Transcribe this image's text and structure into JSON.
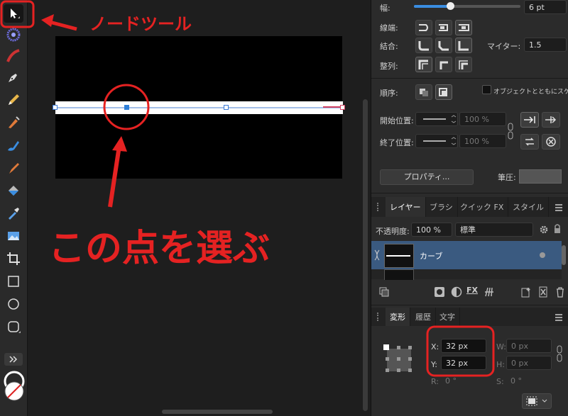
{
  "annotations": {
    "node_tool": "ノードツール",
    "select_point": "この点を選ぶ"
  },
  "icons": {
    "tools": [
      "node-tool",
      "color-wheel",
      "brush",
      "pen",
      "pencil",
      "vector-brush",
      "fill-brush",
      "paint-brush",
      "fill-bucket",
      "eyedropper",
      "image",
      "crop",
      "rectangle",
      "ellipse",
      "rounded-rectangle"
    ]
  },
  "stroke": {
    "width_label": "幅:",
    "width_value": "6 pt",
    "cap_label": "線端:",
    "join_label": "結合:",
    "miter_label": "マイター:",
    "miter_value": "1.5",
    "align_label": "整列:",
    "order_label": "順序:",
    "scale_with_object": "オブジェクトとともにスケーリング",
    "start_label": "開始位置:",
    "end_label": "終了位置:",
    "start_pct": "100 %",
    "end_pct": "100 %",
    "properties_button": "プロパティ...",
    "pressure_label": "筆圧:"
  },
  "layers": {
    "tabs": [
      "レイヤー",
      "ブラシ",
      "クイック FX",
      "スタイル"
    ],
    "opacity_label": "不透明度:",
    "opacity_value": "100 %",
    "blend_mode": "標準",
    "layer_name": "カーブ",
    "fx_label": "FX"
  },
  "transform": {
    "tabs": [
      "変形",
      "履歴",
      "文字"
    ],
    "x_label": "X:",
    "x_value": "32 px",
    "y_label": "Y:",
    "y_value": "32 px",
    "w_label": "W:",
    "w_value": "0 px",
    "h_label": "H:",
    "h_value": "0 px",
    "r_label": "R:",
    "r_value": "0 °",
    "s_label": "S:",
    "s_value": "0 °"
  },
  "colors": {
    "annotation_red": "#e52222",
    "layer_selected": "#3a5a80",
    "accent_blue": "#2f7fd8"
  }
}
